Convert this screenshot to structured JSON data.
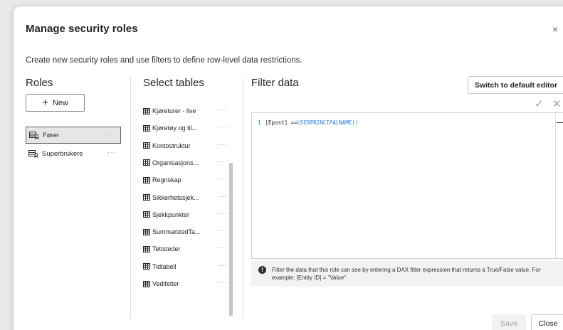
{
  "dialog": {
    "title": "Manage security roles",
    "description": "Create new security roles and use filters to define row-level data restrictions.",
    "close_glyph": "×"
  },
  "roles": {
    "heading": "Roles",
    "new_label": "New",
    "items": [
      {
        "label": "Fører",
        "selected": true,
        "icon": "role-icon"
      },
      {
        "label": "Superbrukere",
        "selected": false,
        "icon": "role-icon"
      }
    ],
    "more_glyph": "···"
  },
  "tables": {
    "heading": "Select tables",
    "items": [
      {
        "label": "Kjøreturer - live"
      },
      {
        "label": "Kjøretøy og til..."
      },
      {
        "label": "Kontostruktur"
      },
      {
        "label": "Organisasjons..."
      },
      {
        "label": "Regnskap"
      },
      {
        "label": "Sikkerhetssjek..."
      },
      {
        "label": "Sjekkpunkter"
      },
      {
        "label": "SummarizedTa..."
      },
      {
        "label": "Tettsteder"
      },
      {
        "label": "Tidtabell"
      },
      {
        "label": "Vedifelter"
      }
    ]
  },
  "filter": {
    "heading": "Filter data",
    "switch_label": "Switch to default editor",
    "code_line_number": "1",
    "code_part1": "[Epost] ==",
    "code_part2": "USERPRINCIPALNAME()",
    "info_text": "Filter the data that this role can see by entering a DAX filter expression that returns a True/False value. For example: [Entity ID] = \"Value\""
  },
  "footer": {
    "save_label": "Save",
    "close_label": "Close"
  },
  "colors": {
    "accent_code": "#2b7ccf",
    "selected_border": "#5c5c5c"
  }
}
